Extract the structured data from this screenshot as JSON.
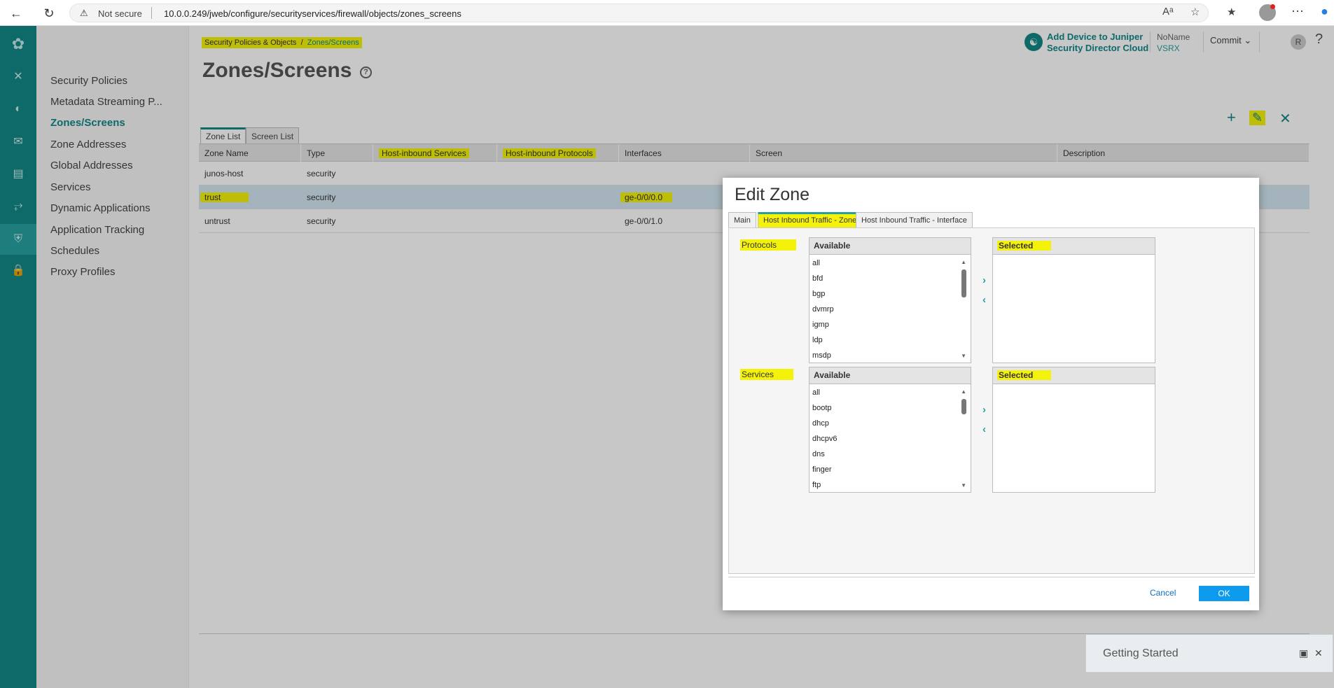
{
  "browser": {
    "security_label": "Not secure",
    "url": "10.0.0.249/jweb/configure/securityservices/firewall/objects/zones_screens"
  },
  "sidebar": {
    "items": [
      {
        "label": "Security Policies"
      },
      {
        "label": "Metadata Streaming P..."
      },
      {
        "label": "Zones/Screens"
      },
      {
        "label": "Zone Addresses"
      },
      {
        "label": "Global Addresses"
      },
      {
        "label": "Services"
      },
      {
        "label": "Dynamic Applications"
      },
      {
        "label": "Application Tracking"
      },
      {
        "label": "Schedules"
      },
      {
        "label": "Proxy Profiles"
      }
    ]
  },
  "header": {
    "breadcrumb_parent": "Security Policies & Objects",
    "breadcrumb_sep": "/",
    "breadcrumb_current": "Zones/Screens",
    "page_title": "Zones/Screens",
    "sd_link_line1": "Add Device to Juniper",
    "sd_link_line2": "Security Director Cloud",
    "device_name": "NoName",
    "device_model": "VSRX",
    "commit_label": "Commit",
    "user_initial": "R",
    "help": "?"
  },
  "tabs": [
    {
      "label": "Zone List"
    },
    {
      "label": "Screen List"
    }
  ],
  "table": {
    "columns": [
      "Zone Name",
      "Type",
      "Host-inbound Services",
      "Host-inbound Protocols",
      "Interfaces",
      "Screen",
      "Description"
    ],
    "rows": [
      {
        "zone": "junos-host",
        "type": "security",
        "interfaces": ""
      },
      {
        "zone": "trust",
        "type": "security",
        "interfaces": "ge-0/0/0.0"
      },
      {
        "zone": "untrust",
        "type": "security",
        "interfaces": "ge-0/0/1.0"
      }
    ]
  },
  "modal": {
    "title": "Edit Zone",
    "tabs": [
      "Main",
      "Host Inbound Traffic - Zone",
      "Host Inbound Traffic - Interface"
    ],
    "protocols_label": "Protocols",
    "services_label": "Services",
    "available_label": "Available",
    "selected_label": "Selected",
    "protocols_available": [
      "all",
      "bfd",
      "bgp",
      "dvmrp",
      "igmp",
      "ldp",
      "msdp"
    ],
    "services_available": [
      "all",
      "bootp",
      "dhcp",
      "dhcpv6",
      "dns",
      "finger",
      "ftp"
    ],
    "cancel_label": "Cancel",
    "ok_label": "OK"
  },
  "getting_started": {
    "title": "Getting Started"
  },
  "colors": {
    "brand": "#128787",
    "highlight": "#f4f20a",
    "ok_button": "#0d9bee"
  }
}
